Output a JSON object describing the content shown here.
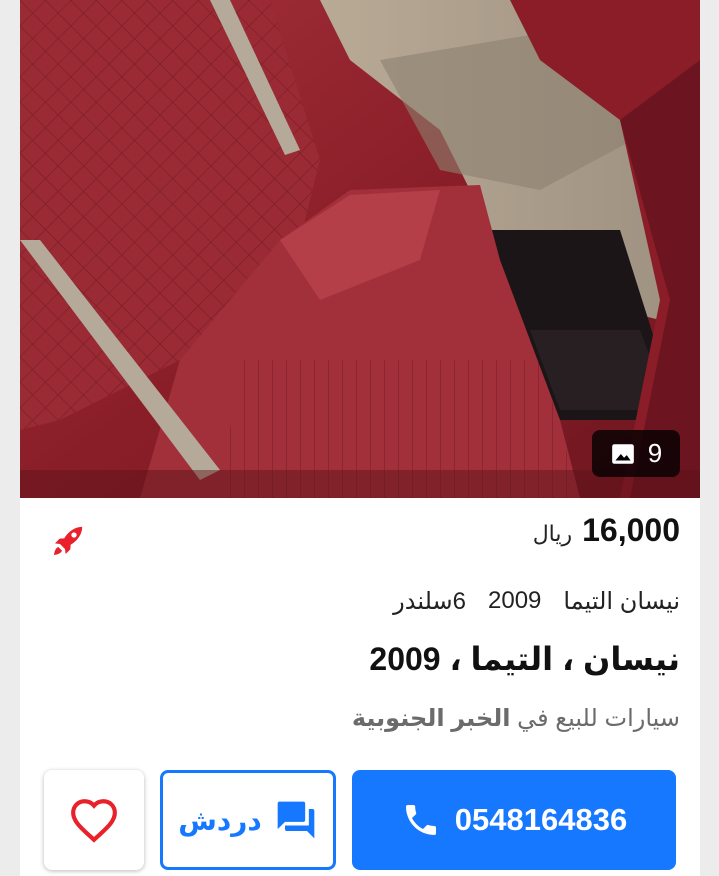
{
  "listing": {
    "photo_count": "9",
    "price": "16,000",
    "currency": "ريال",
    "specs": [
      "نيسان التيما",
      "2009",
      "6سلندر"
    ],
    "title": "نيسان ، التيما ، 2009",
    "location_prefix": "سيارات للبيع في",
    "location_city": "الخبر الجنوبية"
  },
  "actions": {
    "phone": "0548164836",
    "chat_label": "دردش"
  },
  "icons": {
    "photo": "image-icon",
    "boost": "rocket-icon",
    "call": "phone-icon",
    "chat": "chat-icon",
    "favorite": "heart-icon"
  },
  "colors": {
    "accent": "#1677ff",
    "boost": "#e8212a",
    "heart": "#e8212a",
    "upholstery": "#8e1f2a"
  }
}
